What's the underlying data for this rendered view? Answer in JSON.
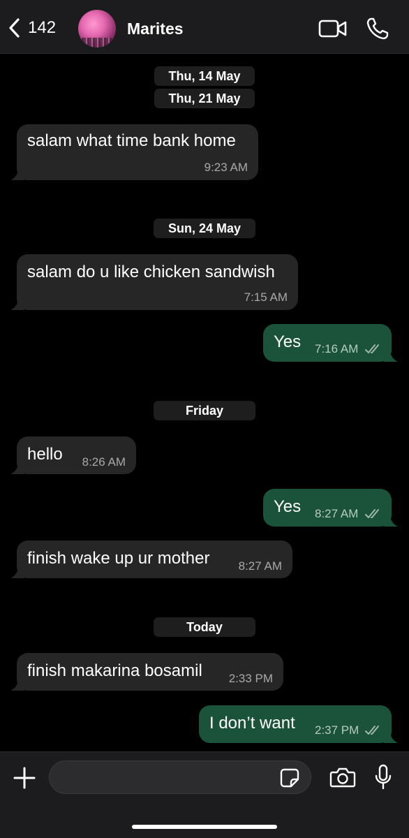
{
  "header": {
    "back_count": "142",
    "contact_name": "Marites",
    "icons": {
      "back": "chevron-left-icon",
      "video": "video-camera-icon",
      "call": "phone-icon"
    }
  },
  "dates": {
    "d1": "Thu, 14 May",
    "d2": "Thu, 21 May",
    "d3": "Sun, 24 May",
    "d4": "Friday",
    "d5": "Today"
  },
  "messages": [
    {
      "direction": "incoming",
      "text": "salam what time bank home",
      "time": "9:23 AM"
    },
    {
      "direction": "incoming",
      "text": "salam do u like chicken sandwish",
      "time": "7:15 AM"
    },
    {
      "direction": "outgoing",
      "text": "Yes",
      "time": "7:16 AM",
      "status": "read"
    },
    {
      "direction": "incoming",
      "text": "hello",
      "time": "8:26 AM"
    },
    {
      "direction": "outgoing",
      "text": "Yes",
      "time": "8:27 AM",
      "status": "read"
    },
    {
      "direction": "incoming",
      "text": "finish wake up ur mother",
      "time": "8:27 AM"
    },
    {
      "direction": "incoming",
      "text": "finish makarina bosamil",
      "time": "2:33 PM"
    },
    {
      "direction": "outgoing",
      "text": "I don’t want",
      "time": "2:37 PM",
      "status": "read"
    }
  ],
  "input": {
    "placeholder": "",
    "value": "",
    "icons": {
      "add": "plus-icon",
      "sticker": "sticker-icon",
      "camera": "camera-icon",
      "mic": "microphone-icon"
    }
  },
  "colors": {
    "background": "#000000",
    "bar": "#1c1c1e",
    "incoming_bubble": "#262626",
    "outgoing_bubble": "#1a5339",
    "read_ticks": "#9fb8ab"
  }
}
